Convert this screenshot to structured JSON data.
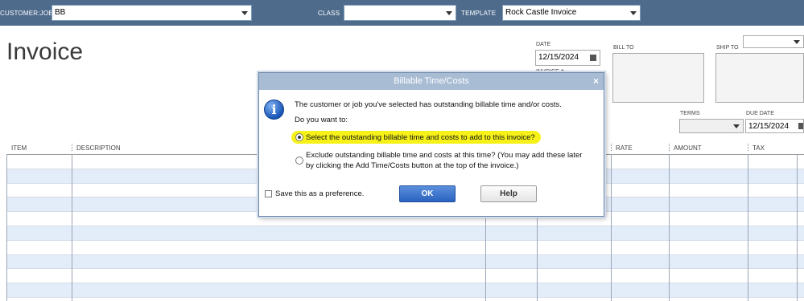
{
  "topbar": {
    "customer_job_label": "CUSTOMER:JOB",
    "customer_job_value": "BB",
    "class_label": "CLASS",
    "class_value": "",
    "template_label": "TEMPLATE",
    "template_value": "Rock Castle Invoice"
  },
  "invoice": {
    "title": "Invoice",
    "date_label": "DATE",
    "date_value": "12/15/2024",
    "invoice_no_label": "INVOICE #",
    "bill_to_label": "BILL TO",
    "ship_to_label": "SHIP TO",
    "terms_label": "TERMS",
    "terms_value": "",
    "due_date_label": "DUE DATE",
    "due_date_value": "12/15/2024"
  },
  "table": {
    "columns": [
      "ITEM",
      "DESCRIPTION",
      "RATE",
      "AMOUNT",
      "TAX"
    ]
  },
  "dialog": {
    "title": "Billable Time/Costs",
    "close": "×",
    "message": "The customer or job you've selected has outstanding billable time and/or costs.",
    "question": "Do you want to:",
    "option1": "Select the outstanding billable time and costs to add to this invoice?",
    "option2_line1": "Exclude outstanding billable time and costs at this time? (You may add these later",
    "option2_line2": "by clicking the Add Time/Costs button at the top of the invoice.)",
    "save_pref": "Save this as a preference.",
    "ok": "OK",
    "help": "Help",
    "selected_option": 1
  }
}
